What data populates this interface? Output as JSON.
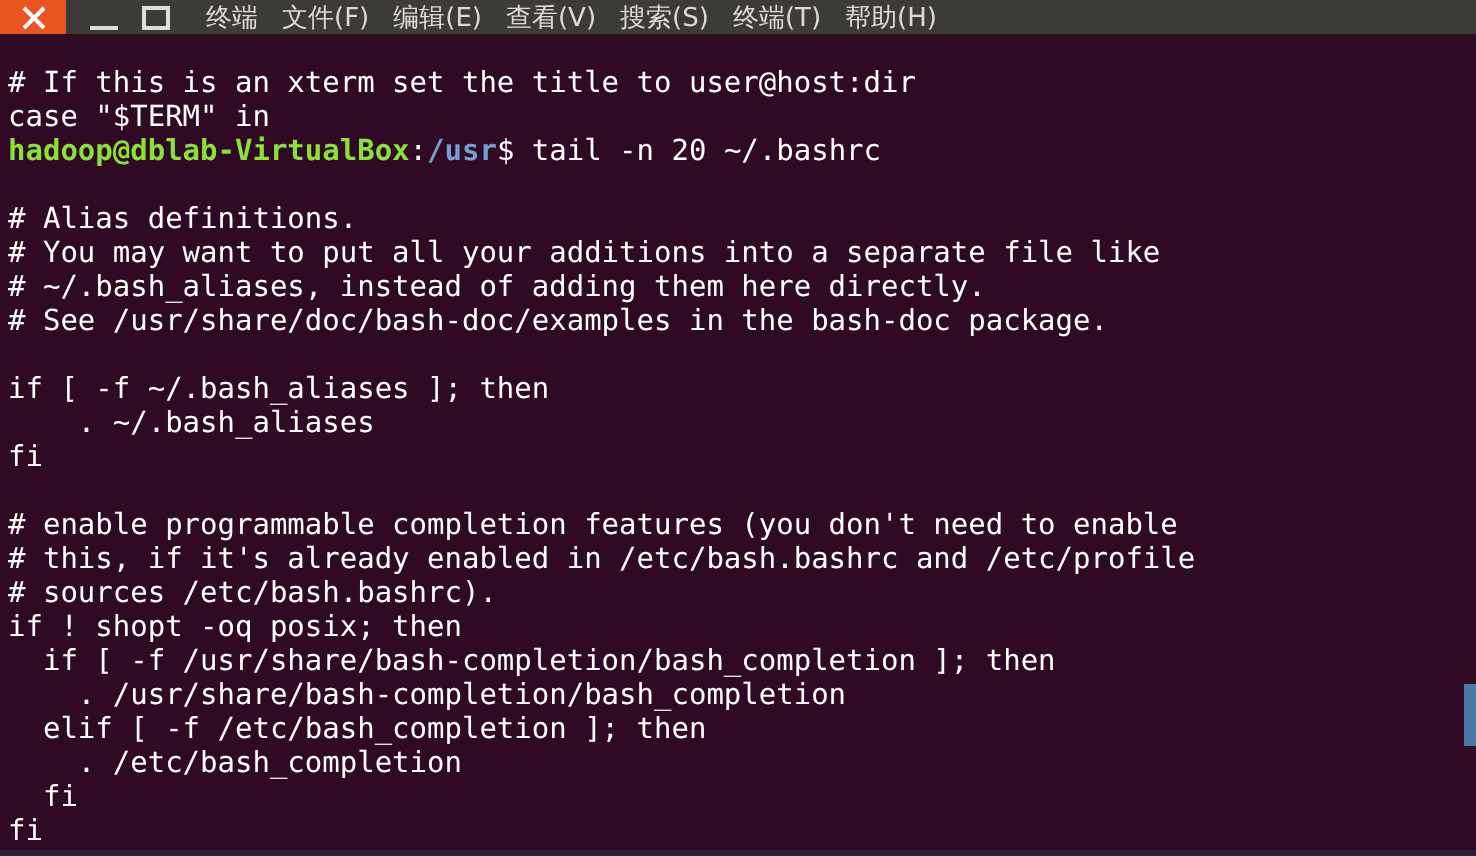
{
  "menu_bar": {
    "items": [
      "终端",
      "文件(F)",
      "编辑(E)",
      "查看(V)",
      "搜索(S)",
      "终端(T)",
      "帮助(H)"
    ]
  },
  "terminal": {
    "lines": [
      {
        "kind": "blank"
      },
      {
        "kind": "text",
        "text": "# If this is an xterm set the title to user@host:dir"
      },
      {
        "kind": "text",
        "text": "case \"$TERM\" in"
      },
      {
        "kind": "prompt",
        "user_host": "hadoop@dblab-VirtualBox",
        "separator": ":",
        "path": "/usr",
        "command": "$ tail -n 20 ~/.bashrc"
      },
      {
        "kind": "blank"
      },
      {
        "kind": "text",
        "text": "# Alias definitions."
      },
      {
        "kind": "text",
        "text": "# You may want to put all your additions into a separate file like"
      },
      {
        "kind": "text",
        "text": "# ~/.bash_aliases, instead of adding them here directly."
      },
      {
        "kind": "text",
        "text": "# See /usr/share/doc/bash-doc/examples in the bash-doc package."
      },
      {
        "kind": "blank"
      },
      {
        "kind": "text",
        "text": "if [ -f ~/.bash_aliases ]; then"
      },
      {
        "kind": "text",
        "text": "    . ~/.bash_aliases"
      },
      {
        "kind": "text",
        "text": "fi"
      },
      {
        "kind": "blank"
      },
      {
        "kind": "text",
        "text": "# enable programmable completion features (you don't need to enable"
      },
      {
        "kind": "text",
        "text": "# this, if it's already enabled in /etc/bash.bashrc and /etc/profile"
      },
      {
        "kind": "text",
        "text": "# sources /etc/bash.bashrc)."
      },
      {
        "kind": "text",
        "text": "if ! shopt -oq posix; then"
      },
      {
        "kind": "text",
        "text": "  if [ -f /usr/share/bash-completion/bash_completion ]; then"
      },
      {
        "kind": "text",
        "text": "    . /usr/share/bash-completion/bash_completion"
      },
      {
        "kind": "text",
        "text": "  elif [ -f /etc/bash_completion ]; then"
      },
      {
        "kind": "text",
        "text": "    . /etc/bash_completion"
      },
      {
        "kind": "text",
        "text": "  fi"
      },
      {
        "kind": "text",
        "text": "fi"
      }
    ]
  }
}
